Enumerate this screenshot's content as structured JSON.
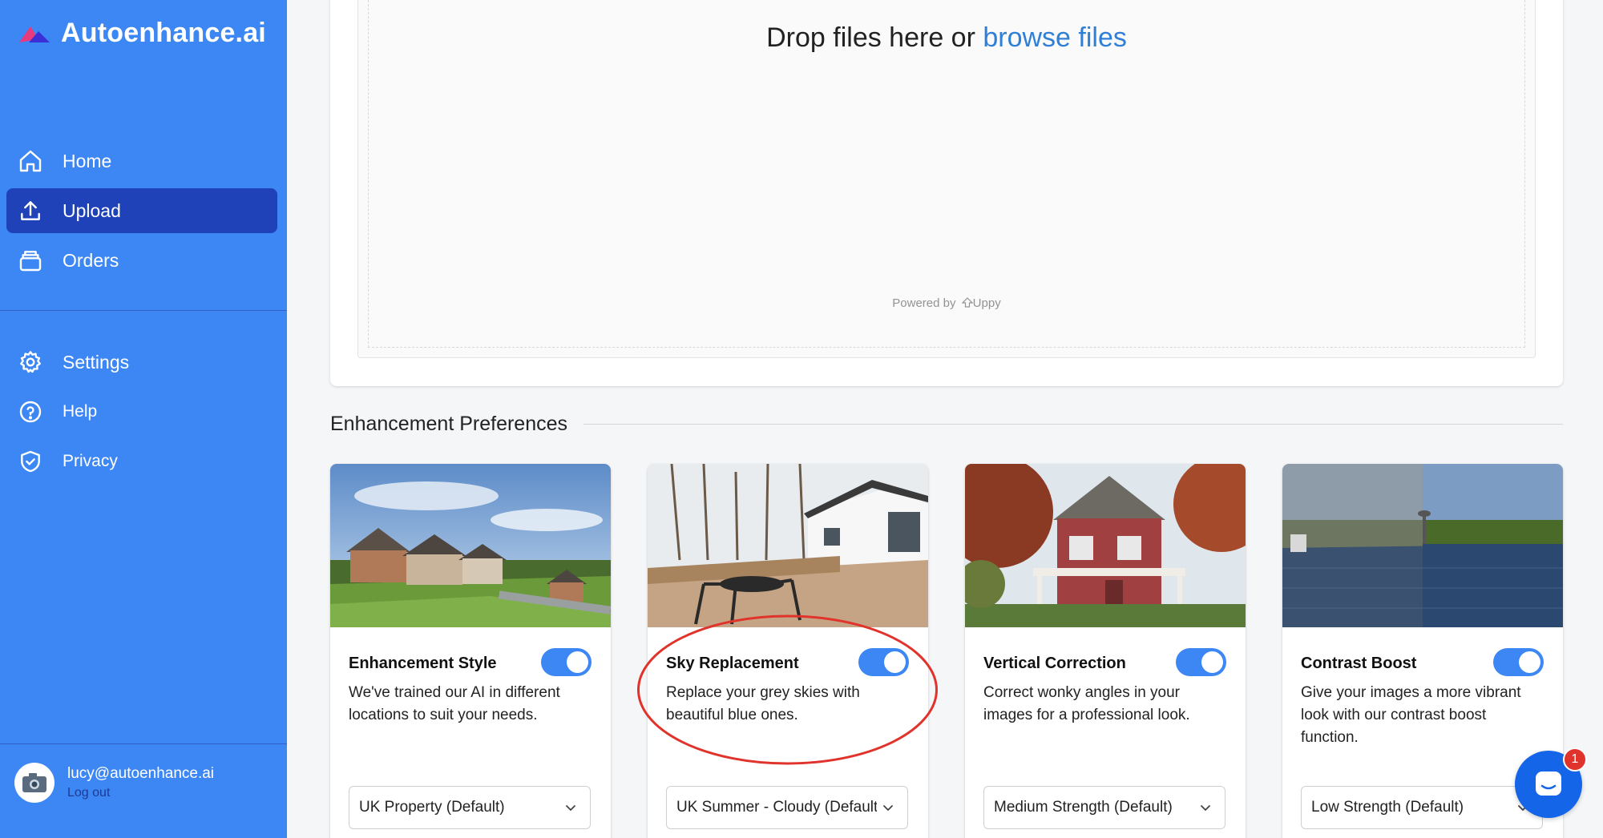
{
  "brand": {
    "name": "Autoenhance.ai"
  },
  "nav_main": [
    {
      "label": "Home",
      "icon": "home-icon",
      "active": false
    },
    {
      "label": "Upload",
      "icon": "upload-icon",
      "active": true
    },
    {
      "label": "Orders",
      "icon": "orders-icon",
      "active": false
    }
  ],
  "nav_secondary": [
    {
      "label": "Settings",
      "icon": "gear-icon"
    },
    {
      "label": "Help",
      "icon": "help-icon"
    },
    {
      "label": "Privacy",
      "icon": "shield-icon"
    }
  ],
  "user": {
    "email": "lucy@autoenhance.ai",
    "logout": "Log out"
  },
  "dropzone": {
    "text": "Drop files here or ",
    "link": "browse files",
    "powered_by": "Powered by",
    "powered_brand": "Uppy"
  },
  "preferences": {
    "title": "Enhancement Preferences",
    "cards": [
      {
        "title": "Enhancement Style",
        "description": "We've trained our AI in different locations to suit your needs.",
        "enabled": true,
        "select_value": "UK Property (Default)"
      },
      {
        "title": "Sky Replacement",
        "description": "Replace your grey skies with beautiful blue ones.",
        "enabled": true,
        "select_value": "UK Summer - Cloudy (Default)"
      },
      {
        "title": "Vertical Correction",
        "description": "Correct wonky angles in your images for a professional look.",
        "enabled": true,
        "select_value": "Medium Strength (Default)"
      },
      {
        "title": "Contrast Boost",
        "description": "Give your images a more vibrant look with our contrast boost function.",
        "enabled": true,
        "select_value": "Low Strength (Default)"
      }
    ]
  },
  "chat": {
    "badge_count": "1"
  },
  "colors": {
    "sidebar": "#3d87f5",
    "active_nav": "#1f42b8",
    "toggle_on": "#3d87f5",
    "link": "#2f7fd6",
    "annotation": "#e0332b"
  }
}
